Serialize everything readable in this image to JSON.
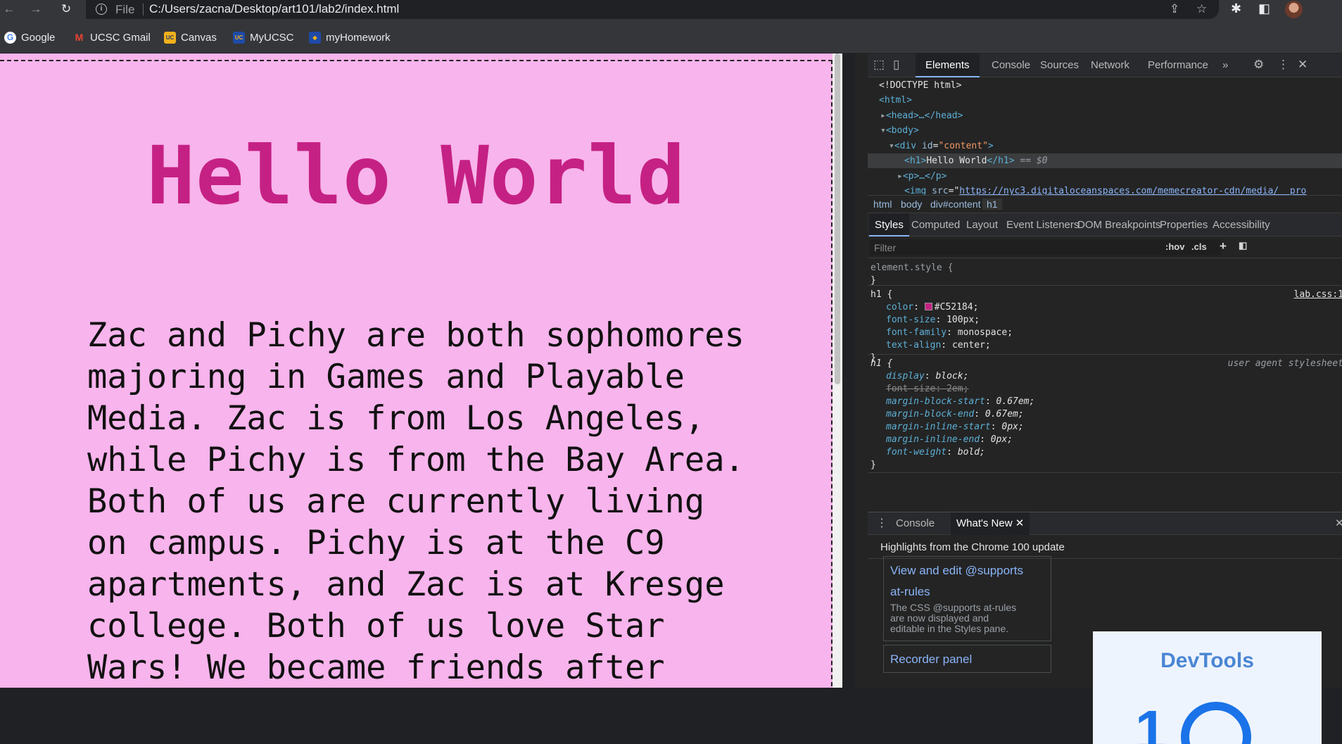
{
  "browser": {
    "url_scheme": "File",
    "url": "C:/Users/zacna/Desktop/art101/lab2/index.html",
    "nav": {
      "back_icon": "arrow-left-icon",
      "forward_icon": "arrow-right-icon",
      "reload_icon": "reload-icon"
    }
  },
  "bookmarks": [
    {
      "label": "Google",
      "icon": "google-icon",
      "color": "#4285f4"
    },
    {
      "label": "UCSC Gmail",
      "icon": "gmail-icon",
      "color": "#ea4335"
    },
    {
      "label": "Canvas",
      "icon": "ucsc-icon",
      "color": "#f2b11b"
    },
    {
      "label": "MyUCSC",
      "icon": "ucsc-icon",
      "color": "#1e4aa8"
    },
    {
      "label": "myHomework",
      "icon": "myhomework-icon",
      "color": "#f2b11b"
    }
  ],
  "page": {
    "heading": "Hello World",
    "heading_color": "#C52184",
    "background_color": "#f8b4ec",
    "paragraph": "Zac and Pichy are both sophomores majoring in Games and Playable Media. Zac is from Los Angeles, while Pichy is from the Bay Area. Both of us are currently living on campus. Pichy is at the C9 apartments, and Zac is at Kresge college. Both of us love Star Wars! We became friends after"
  },
  "devtools": {
    "tabs": [
      "Elements",
      "Console",
      "Sources",
      "Network",
      "Performance"
    ],
    "more_tabs": "»",
    "dom": {
      "doctype": "<!DOCTYPE html>",
      "html_open": "<html>",
      "head": "<head>…</head>",
      "body_open": "<body>",
      "div_tag": "div",
      "div_attr": "id",
      "div_value": "\"content\"",
      "h1_text": "Hello World",
      "h1_suffix": "== $0",
      "p_line": "<p>…</p>",
      "img_attr": "src",
      "img_url": "https://nyc3.digitaloceanspaces.com/memecreator-cdn/media/__pro"
    },
    "breadcrumbs": [
      "html",
      "body",
      "div#content",
      "h1"
    ],
    "sub_tabs": [
      "Styles",
      "Computed",
      "Layout",
      "Event Listeners",
      "DOM Breakpoints",
      "Properties",
      "Accessibility"
    ],
    "filter": {
      "placeholder": "Filter",
      "hov": ":hov",
      "cls": ".cls"
    },
    "styles": {
      "element_style": "element.style {",
      "close_brace": "}",
      "rule1": {
        "selector": "h1 {",
        "source": "lab.css:1",
        "decls": [
          {
            "prop": "color",
            "value": "#C52184;"
          },
          {
            "prop": "font-size",
            "value": "100px;"
          },
          {
            "prop": "font-family",
            "value": "monospace;"
          },
          {
            "prop": "text-align",
            "value": "center;"
          }
        ]
      },
      "rule2": {
        "selector": "h1 {",
        "source": "user agent stylesheet",
        "decls": [
          {
            "prop": "display",
            "value": "block;"
          },
          {
            "prop": "font-size",
            "value": "2em;"
          },
          {
            "prop": "margin-block-start",
            "value": "0.67em;"
          },
          {
            "prop": "margin-block-end",
            "value": "0.67em;"
          },
          {
            "prop": "margin-inline-start",
            "value": "0px;"
          },
          {
            "prop": "margin-inline-end",
            "value": "0px;"
          },
          {
            "prop": "font-weight",
            "value": "bold;"
          }
        ]
      }
    },
    "drawer": {
      "tabs": [
        "Console",
        "What's New"
      ],
      "whats_new_header": "Highlights from the Chrome 100 update",
      "card1_title_a": "View and edit @supports",
      "card1_title_b": "at-rules",
      "card1_desc_a": "The CSS @supports at-rules",
      "card1_desc_b": "are now displayed and",
      "card1_desc_c": "editable in the Styles pane.",
      "card2_title": "Recorder panel",
      "image_text": "DevTools"
    }
  }
}
